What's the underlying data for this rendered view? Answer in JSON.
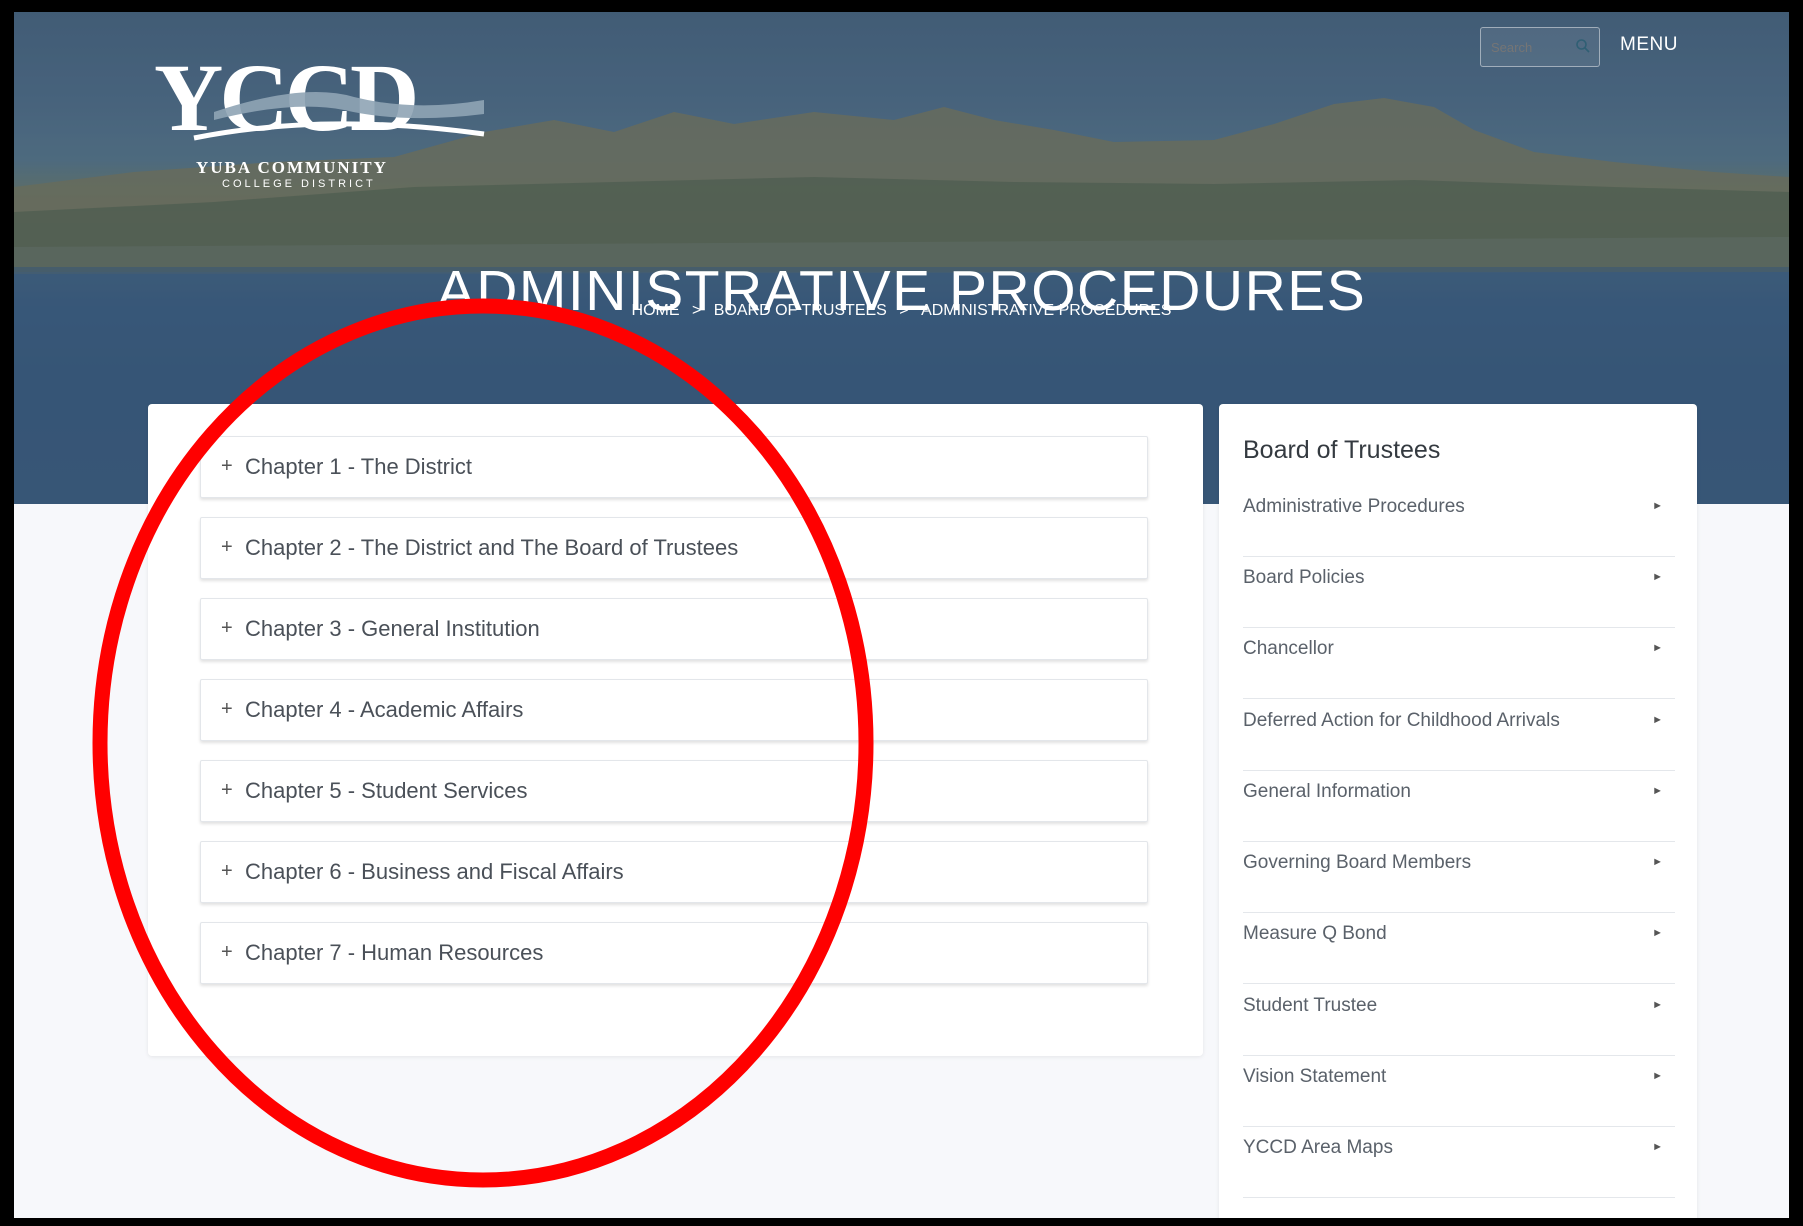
{
  "header": {
    "logo": {
      "mark": "YCCD",
      "line1": "YUBA COMMUNITY",
      "line2": "COLLEGE DISTRICT"
    },
    "search": {
      "placeholder": "Search"
    },
    "menu_label": "MENU"
  },
  "hero": {
    "title": "ADMINISTRATIVE PROCEDURES",
    "breadcrumb": [
      "HOME",
      ">",
      "BOARD OF TRUSTEES",
      ">",
      "ADMINISTRATIVE PROCEDURES"
    ]
  },
  "chapters": [
    {
      "plus": "+",
      "label": "Chapter 1 - The District"
    },
    {
      "plus": "+",
      "label": "Chapter 2 - The District and The Board of Trustees"
    },
    {
      "plus": "+",
      "label": "Chapter 3 - General Institution"
    },
    {
      "plus": "+",
      "label": "Chapter 4 - Academic Affairs"
    },
    {
      "plus": "+",
      "label": "Chapter 5 - Student Services"
    },
    {
      "plus": "+",
      "label": "Chapter 6 - Business and Fiscal Affairs"
    },
    {
      "plus": "+",
      "label": "Chapter 7 - Human Resources"
    }
  ],
  "sidebar": {
    "title": "Board of Trustees",
    "items": [
      {
        "label": "Administrative Procedures",
        "arrow": "►"
      },
      {
        "label": "Board Policies",
        "arrow": "►"
      },
      {
        "label": "Chancellor",
        "arrow": "►"
      },
      {
        "label": "Deferred Action for Childhood Arrivals",
        "arrow": "►"
      },
      {
        "label": "General Information",
        "arrow": "►"
      },
      {
        "label": "Governing Board Members",
        "arrow": "►"
      },
      {
        "label": "Measure Q Bond",
        "arrow": "►"
      },
      {
        "label": "Student Trustee",
        "arrow": "►"
      },
      {
        "label": "Vision Statement",
        "arrow": "►"
      },
      {
        "label": "YCCD Area Maps",
        "arrow": "►"
      }
    ]
  },
  "annotation": {
    "color": "#ff0000"
  },
  "colors": {
    "hero_blue": "#3f6386",
    "page_bg": "#f7f8fb",
    "text": "#4a5058"
  }
}
